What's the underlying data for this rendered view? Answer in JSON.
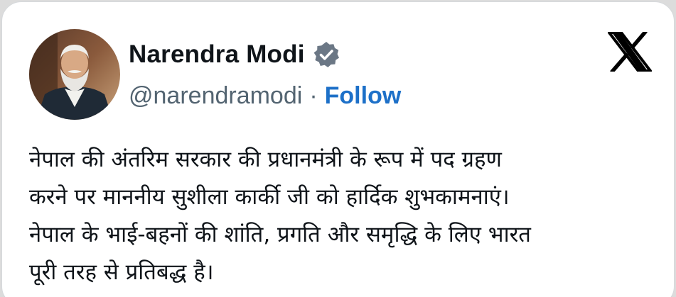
{
  "author": {
    "name": "Narendra Modi",
    "handle": "@narendramodi",
    "separator": "·",
    "follow_label": "Follow",
    "verified": true
  },
  "icons": {
    "avatar": "profile-photo",
    "verified": "verified-badge-icon",
    "platform": "x-logo-icon"
  },
  "colors": {
    "name": "#0f1419",
    "handle": "#536471",
    "follow": "#1d70c8",
    "verified_badge": "#6b7785"
  },
  "tweet": {
    "lines": [
      "नेपाल की अंतरिम सरकार की प्रधानमंत्री के रूप में पद ग्रहण",
      "करने पर माननीय सुशीला कार्की जी को हार्दिक शुभकामनाएं।",
      "नेपाल के भाई-बहनों की शांति, प्रगति और समृद्धि के लिए भारत",
      "पूरी तरह से प्रतिबद्ध है।"
    ]
  }
}
